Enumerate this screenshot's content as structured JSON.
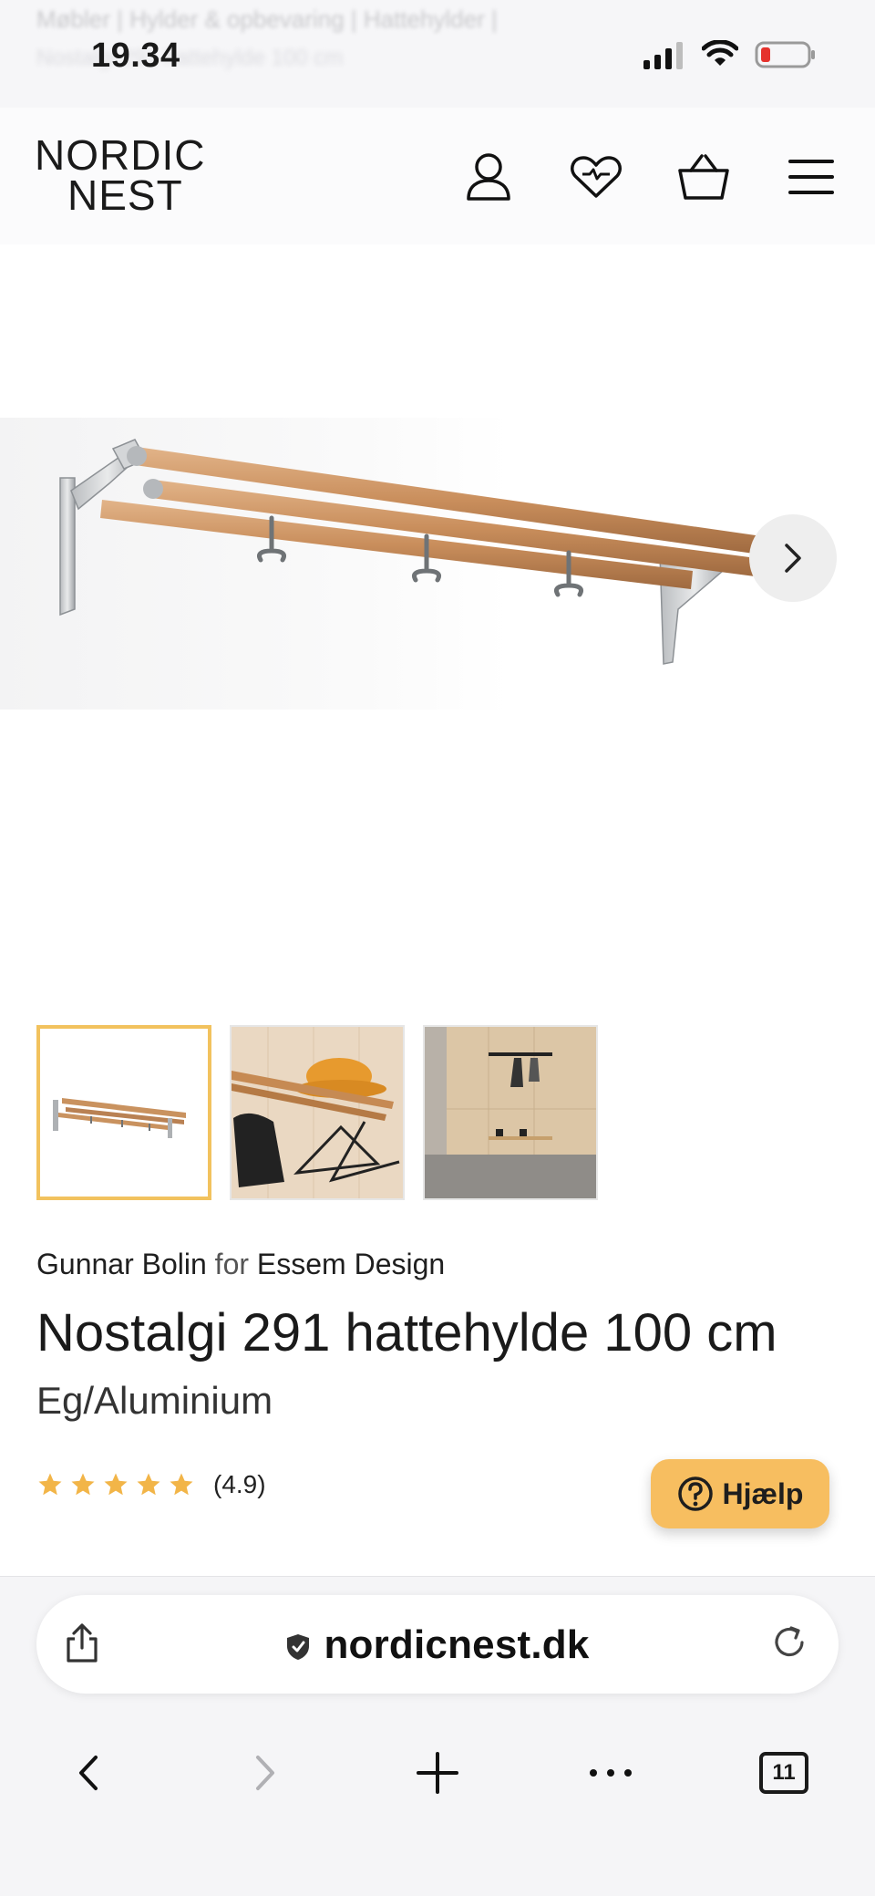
{
  "status_bar": {
    "time": "19.34",
    "ghost_breadcrumb": "Møbler | Hylder & opbevaring | Hattehylder |",
    "ghost_sub": "Nostalgi 291 hattehylde 100 cm",
    "icons": [
      "signal-icon",
      "wifi-icon",
      "battery-low-icon"
    ]
  },
  "header": {
    "logo_line1": "NORDIC",
    "logo_line2": "NEST",
    "icons": [
      "account-icon",
      "wishlist-heart-icon",
      "basket-icon",
      "menu-icon"
    ]
  },
  "hero": {
    "next_icon": "chevron-right-icon"
  },
  "thumbnails": [
    {
      "name": "thumb-hatshelf",
      "selected": true
    },
    {
      "name": "thumb-hat-and-hangers",
      "selected": false
    },
    {
      "name": "thumb-hallway",
      "selected": false
    }
  ],
  "product": {
    "designer": "Gunnar Bolin",
    "for": "for",
    "brand": "Essem Design",
    "title": "Nostalgi 291 hattehylde 100 cm",
    "variant": "Eg/Aluminium",
    "rating": 4.9,
    "rating_text": "(4.9)",
    "stars": 5
  },
  "help_button": {
    "label": "Hjælp",
    "color": "#f7be60"
  },
  "browser": {
    "url": "nordicnest.dk",
    "tab_count": "11",
    "icons": [
      "share-icon",
      "secure-shield-icon",
      "reload-icon",
      "back-icon",
      "forward-icon",
      "new-tab-icon",
      "more-icon",
      "tabs-icon"
    ]
  },
  "colors": {
    "accent": "#f2c25e",
    "star": "#f2b548"
  }
}
